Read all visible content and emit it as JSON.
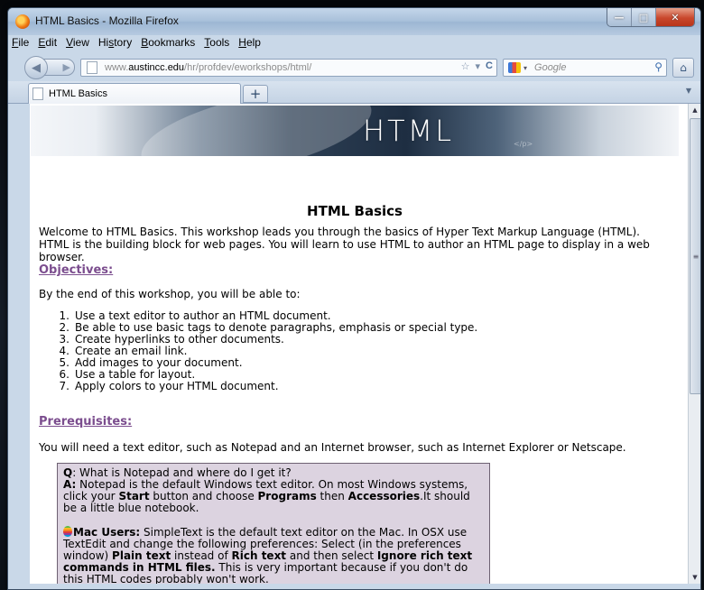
{
  "window": {
    "title": "HTML Basics - Mozilla Firefox",
    "minimize_icon": "minimize-icon",
    "maximize_icon": "maximize-icon",
    "close_icon": "close-icon"
  },
  "menubar": {
    "items": [
      {
        "label": "File",
        "key": "F",
        "rest": "ile"
      },
      {
        "label": "Edit",
        "key": "E",
        "rest": "dit"
      },
      {
        "label": "View",
        "key": "V",
        "rest": "iew"
      },
      {
        "label": "History",
        "pre": "Hi",
        "key": "s",
        "rest": "tory"
      },
      {
        "label": "Bookmarks",
        "key": "B",
        "rest": "ookmarks"
      },
      {
        "label": "Tools",
        "key": "T",
        "rest": "ools"
      },
      {
        "label": "Help",
        "key": "H",
        "rest": "elp"
      }
    ]
  },
  "nav": {
    "url_prefix": "www.",
    "url_domain": "austincc.edu",
    "url_path": "/hr/profdev/eworkshops/html/",
    "search_placeholder": "Google"
  },
  "tabs": [
    {
      "label": "HTML Basics",
      "active": true
    }
  ],
  "new_tab_label": "+",
  "banner": {
    "title": "HTML",
    "tag": "</p>"
  },
  "page": {
    "heading": "HTML Basics",
    "intro": "Welcome to HTML Basics. This workshop leads you through the basics of Hyper Text Markup Language (HTML). HTML is the building block for web pages. You will learn to use HTML to author an HTML page to display in a web browser.",
    "objectives_heading": "Objectives:",
    "objectives_lead": "By the end of this workshop, you will be able to:",
    "objectives": [
      "Use a text editor to author an HTML document.",
      "Be able to use basic tags to denote paragraphs, emphasis or special type.",
      "Create hyperlinks to other documents.",
      "Create an email link.",
      "Add images to your document.",
      "Use a table for layout.",
      "Apply colors to your HTML document."
    ],
    "prereq_heading": "Prerequisites:",
    "prereq_lead": "You will need a text editor, such as Notepad and an Internet browser, such as Internet Explorer or Netscape.",
    "qa": {
      "q_label": "Q",
      "q_text": ": What is Notepad and where do I get it?",
      "a_label": "A:",
      "a_text_1": " Notepad is the default Windows text editor. On most Windows systems, click your ",
      "start": "Start",
      "a_text_2": " button and choose ",
      "programs": "Programs",
      "a_text_3": " then ",
      "accessories": "Accessories",
      "a_text_4": ".It should be a little blue notebook.",
      "mac_label": "Mac Users:",
      "mac_text_1": " SimpleText is the default text editor on the Mac. In OSX use TextEdit and change the following preferences: Select (in the preferences window) ",
      "plain_text": "Plain text",
      "mac_text_2": " instead of ",
      "rich_text": "Rich text",
      "mac_text_3": " and then select ",
      "ignore": "Ignore rich text commands in HTML files.",
      "mac_text_4": " This is very important because if you don't do this HTML codes probably won't work."
    }
  },
  "colors": {
    "heading_link": "#7b4d8e",
    "qa_background": "#dcd3e0"
  }
}
